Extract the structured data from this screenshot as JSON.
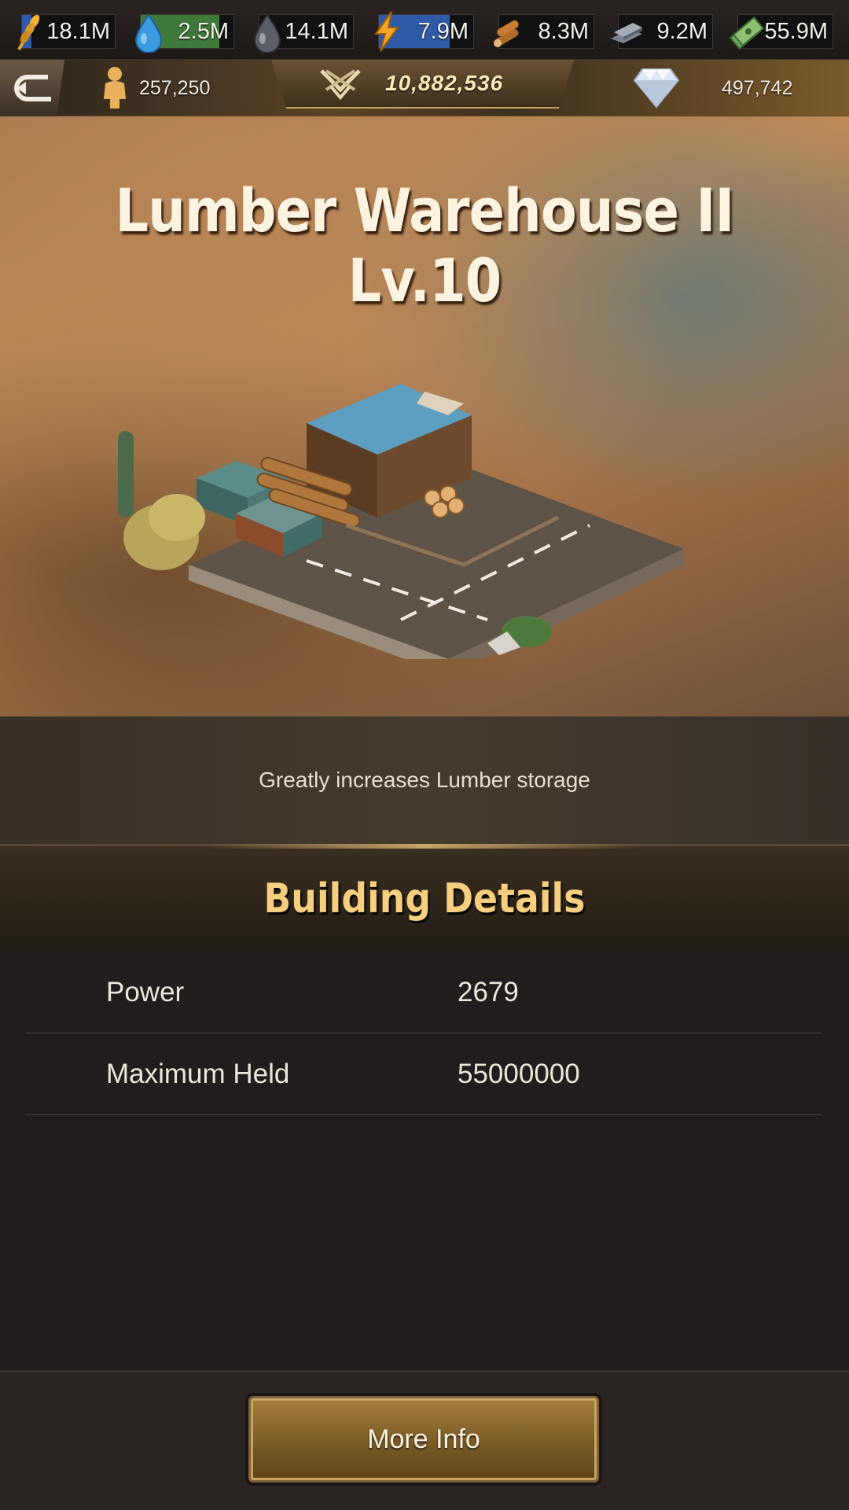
{
  "resources": [
    {
      "name": "food",
      "icon": "wheat-icon",
      "value": "18.1M",
      "fill": 0.1,
      "fill_color": "#2f5aa8"
    },
    {
      "name": "water",
      "icon": "water-drop-icon",
      "value": "2.5M",
      "fill": 0.85,
      "fill_color": "#3f7a3a"
    },
    {
      "name": "oil",
      "icon": "oil-drop-icon",
      "value": "14.1M",
      "fill": 0.0,
      "fill_color": "#2f5aa8"
    },
    {
      "name": "energy",
      "icon": "lightning-icon",
      "value": "7.9M",
      "fill": 0.75,
      "fill_color": "#2f5aa8"
    },
    {
      "name": "lumber",
      "icon": "logs-icon",
      "value": "8.3M",
      "fill": 0.0,
      "fill_color": "#2f5aa8"
    },
    {
      "name": "steel",
      "icon": "steel-bars-icon",
      "value": "9.2M",
      "fill": 0.0,
      "fill_color": "#2f5aa8"
    },
    {
      "name": "cash",
      "icon": "cash-stack-icon",
      "value": "55.9M",
      "fill": 0.0,
      "fill_color": "#2f5aa8"
    }
  ],
  "stats": {
    "population": "257,250",
    "power": "10,882,536",
    "diamonds": "497,742"
  },
  "building": {
    "title": "Lumber Warehouse II Lv.10",
    "description": "Greatly increases Lumber storage"
  },
  "details": {
    "header": "Building Details",
    "rows": [
      {
        "label": "Power",
        "value": "2679"
      },
      {
        "label": "Maximum Held",
        "value": "55000000"
      }
    ]
  },
  "footer": {
    "more_info_label": "More Info"
  }
}
